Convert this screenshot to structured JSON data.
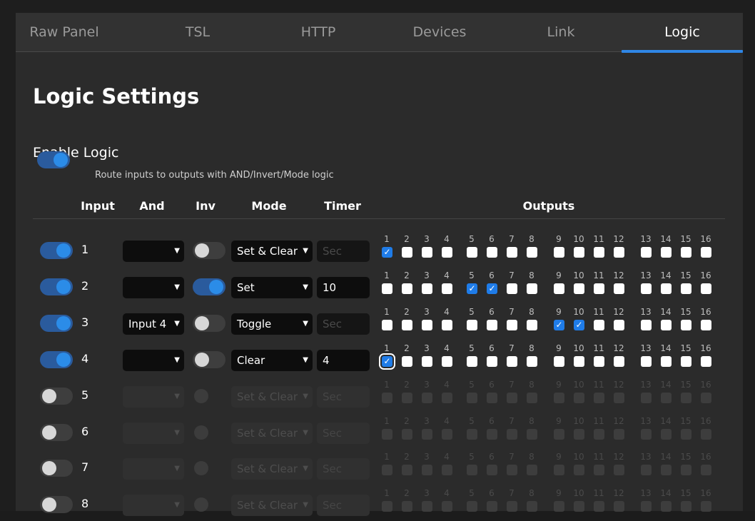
{
  "tabs": [
    "Raw Panel",
    "TSL",
    "HTTP",
    "Devices",
    "Link",
    "Logic"
  ],
  "active_tab": "Logic",
  "title": "Logic Settings",
  "enable": {
    "label": "Enable Logic",
    "description": "Route inputs to outputs with AND/Invert/Mode logic",
    "enabled": true
  },
  "headers": {
    "input": "Input",
    "and": "And",
    "inv": "Inv",
    "mode": "Mode",
    "timer": "Timer",
    "outputs": "Outputs"
  },
  "timer_placeholder": "Sec",
  "output_numbers": [
    "1",
    "2",
    "3",
    "4",
    "5",
    "6",
    "7",
    "8",
    "9",
    "10",
    "11",
    "12",
    "13",
    "14",
    "15",
    "16"
  ],
  "accent_color": "#2b8ce8",
  "rows": [
    {
      "input": "1",
      "enabled": true,
      "and": "",
      "inv": false,
      "mode": "Set & Clear",
      "timer": "",
      "outputs": [
        1
      ]
    },
    {
      "input": "2",
      "enabled": true,
      "and": "",
      "inv": true,
      "mode": "Set",
      "timer": "10",
      "outputs": [
        5,
        6
      ]
    },
    {
      "input": "3",
      "enabled": true,
      "and": "Input 4",
      "inv": false,
      "mode": "Toggle",
      "timer": "",
      "outputs": [
        9,
        10
      ]
    },
    {
      "input": "4",
      "enabled": true,
      "and": "",
      "inv": false,
      "mode": "Clear",
      "timer": "4",
      "outputs": [
        1
      ]
    },
    {
      "input": "5",
      "enabled": false,
      "and": "",
      "inv": false,
      "mode": "Set & Clear",
      "timer": "",
      "outputs": []
    },
    {
      "input": "6",
      "enabled": false,
      "and": "",
      "inv": false,
      "mode": "Set & Clear",
      "timer": "",
      "outputs": []
    },
    {
      "input": "7",
      "enabled": false,
      "and": "",
      "inv": false,
      "mode": "Set & Clear",
      "timer": "",
      "outputs": []
    },
    {
      "input": "8",
      "enabled": false,
      "and": "",
      "inv": false,
      "mode": "Set & Clear",
      "timer": "",
      "outputs": []
    }
  ]
}
